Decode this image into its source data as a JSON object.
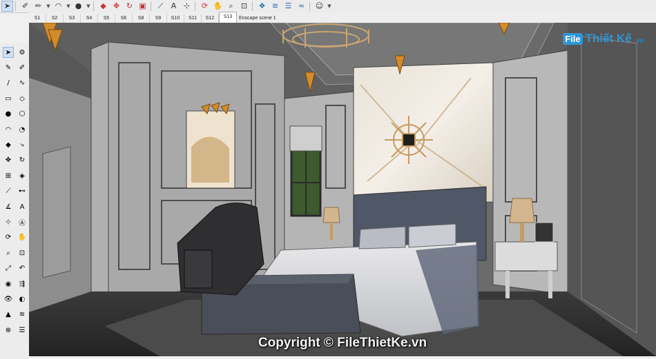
{
  "toolbar": {
    "tools": [
      {
        "name": "select-tool",
        "glyph": "➤",
        "active": true
      },
      {
        "name": "eraser-tool",
        "glyph": "✎"
      },
      {
        "name": "pencil-tool",
        "glyph": "✏"
      },
      {
        "name": "arc-tool",
        "glyph": "◠"
      },
      {
        "name": "material-tool",
        "glyph": "●"
      },
      {
        "name": "offset-tool",
        "glyph": "◈"
      },
      {
        "name": "pushpull-tool",
        "glyph": "◆"
      },
      {
        "name": "rotate-tool",
        "glyph": "↻"
      },
      {
        "name": "scale-tool",
        "glyph": "▣"
      },
      {
        "name": "tape-tool",
        "glyph": "⟋"
      },
      {
        "name": "text-tool",
        "glyph": "A"
      },
      {
        "name": "orbit-tool",
        "glyph": "⟳"
      },
      {
        "name": "zoom-tool",
        "glyph": "⌕"
      },
      {
        "name": "zoom-window-tool",
        "glyph": "⊡"
      },
      {
        "name": "components-tool",
        "glyph": "❖"
      },
      {
        "name": "styles-tool",
        "glyph": "≋"
      },
      {
        "name": "layers-tool",
        "glyph": "☰"
      },
      {
        "name": "extension-tool",
        "glyph": "≈"
      },
      {
        "name": "account-tool",
        "glyph": "☺"
      }
    ]
  },
  "scenes": {
    "tabs": [
      "S1",
      "S2",
      "S3",
      "S4",
      "S5",
      "S6",
      "S8",
      "S9",
      "S10",
      "S11",
      "S12",
      "S13"
    ],
    "active": "S13",
    "active_title": "Enscape scene 1"
  },
  "sidebar": {
    "tools": [
      "select",
      "component",
      "paint",
      "eraser",
      "line",
      "freehand",
      "rectangle",
      "rotated-rect",
      "circle",
      "polygon",
      "arc",
      "pie",
      "pushpull",
      "followme",
      "move",
      "rotate",
      "scale",
      "offset",
      "tape",
      "dimension",
      "protractor",
      "text",
      "axes",
      "3dtext",
      "orbit",
      "pan",
      "zoom",
      "zoom-window",
      "zoom-extents",
      "previous",
      "position-camera",
      "walk",
      "look-around",
      "section",
      "sandbox",
      "styles",
      "solid-tools",
      "outliner"
    ]
  },
  "watermark": {
    "badge": "File",
    "name": "Thiết Kế",
    "domain": ".vn",
    "copyright": "Copyright © FileThietKe.vn"
  },
  "colors": {
    "ui_bg": "#ececec",
    "accent": "#2f96d6",
    "wall": "#9a9a9a",
    "ceiling": "#5c5c5c",
    "bed": "#5b6375"
  }
}
